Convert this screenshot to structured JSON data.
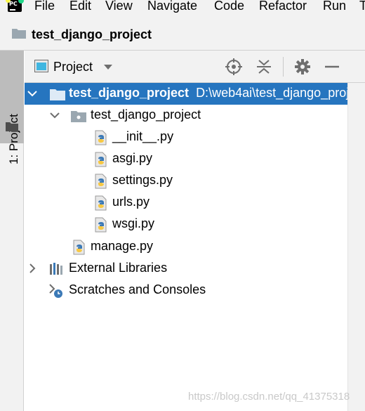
{
  "menu": [
    "File",
    "Edit",
    "View",
    "Navigate",
    "Code",
    "Refactor",
    "Run",
    "T"
  ],
  "breadcrumb": "test_django_project",
  "side_tab": {
    "label": "1: Project"
  },
  "panel": {
    "view_label": "Project",
    "icons": [
      "locate-icon",
      "collapse-all-icon",
      "gear-icon",
      "hide-icon"
    ]
  },
  "tree": {
    "root": {
      "name": "test_django_project",
      "path": "D:\\web4ai\\test_django_proj"
    },
    "package": "test_django_project",
    "files": [
      "__init__.py",
      "asgi.py",
      "settings.py",
      "urls.py",
      "wsgi.py"
    ],
    "manage": "manage.py",
    "external": "External Libraries",
    "scratches": "Scratches and Consoles"
  },
  "colors": {
    "selection": "#2675bf",
    "folder": "#9aa7b0",
    "python_blue": "#3b79b6",
    "python_yellow": "#f7c843"
  },
  "watermark": "https://blog.csdn.net/qq_41375318"
}
